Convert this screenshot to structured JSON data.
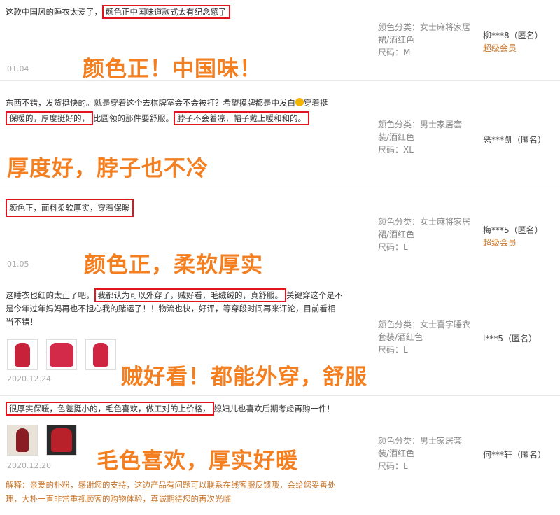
{
  "reviews": [
    {
      "pre": "这款中国风的睡衣太爱了，",
      "hl1": "颜色正中国味道款式太有纪念感了",
      "date": "01.04",
      "sku_line1": "颜色分类：女士麻将家居",
      "sku_line2": "裙/酒红色",
      "size": "尺码：M",
      "user": "柳***8（匿名）",
      "vip": "超级会员",
      "banner": "颜色正！中国味！"
    },
    {
      "line1a": "东西不错，发货挺快的。就是穿着这个去棋牌室会不会被打？希望摸牌都是中发白",
      "line1b": "穿着挺",
      "hl1": "保暖的，厚度挺好的，",
      "mid": "比圆领的那件要舒服。",
      "hl2": "脖子不会着凉，帽子戴上暖和和的。",
      "sku_line1": "颜色分类：男士家居套",
      "sku_line2": "装/酒红色",
      "size": "尺码：XL",
      "user": "恶***凯（匿名）",
      "banner": "厚度好，脖子也不冷"
    },
    {
      "hl1": "颜色正，面料柔软厚实，穿着保暖",
      "date": "01.05",
      "sku_line1": "颜色分类：女士麻将家居",
      "sku_line2": "裙/酒红色",
      "size": "尺码：L",
      "user": "梅***5（匿名）",
      "vip": "超级会员",
      "banner": "颜色正，柔软厚实"
    },
    {
      "pre": "这睡衣也红的太正了吧，",
      "hl1": "我都认为可以外穿了，贼好看，毛绒绒的，真舒服。",
      "post": "关键穿这个是不",
      "line2": "是今年过年妈妈再也不担心我的赌运了！！物流也快，好评，等穿段时间再来评论，目前看相",
      "line3": "当不错！",
      "date": "2020.12.24",
      "sku_line1": "颜色分类：女士喜字睡衣",
      "sku_line2": "套装/酒红色",
      "size": "尺码：L",
      "user": "l***5（匿名）",
      "banner": "贼好看！都能外穿，舒服"
    },
    {
      "hl1": "很厚实保暖，色差挺小的，毛色喜欢，做工对的上价格，",
      "post": "媳妇儿也喜欢后期考虑再购一件！",
      "date": "2020.12.20",
      "sku_line1": "颜色分类：男士家居套",
      "sku_line2": "装/酒红色",
      "size": "尺码：L",
      "user": "何***轩（匿名）",
      "banner": "毛色喜欢，厚实好暖",
      "reply_line1": "解释：亲爱的朴粉，感谢您的支持，这边产品有问题可以联系在线客服反馈哦，会给您妥善处",
      "reply_line2": "理，大朴一直非常重视顾客的购物体验，真诚期待您的再次光临"
    }
  ]
}
